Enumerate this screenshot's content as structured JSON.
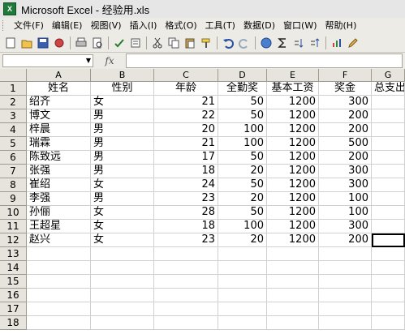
{
  "window": {
    "title": "Microsoft Excel - 经验用.xls",
    "app_icon_glyph": "X"
  },
  "menu": [
    "文件(F)",
    "编辑(E)",
    "视图(V)",
    "插入(I)",
    "格式(O)",
    "工具(T)",
    "数据(D)",
    "窗口(W)",
    "帮助(H)"
  ],
  "toolbar": {
    "icons": [
      "new-icon",
      "open-icon",
      "save-icon",
      "permission-icon",
      "print-icon",
      "print-preview-icon",
      "spelling-icon",
      "research-icon",
      "cut-icon",
      "copy-icon",
      "paste-icon",
      "format-painter-icon",
      "undo-icon",
      "redo-icon",
      "hyperlink-icon",
      "autosum-icon",
      "sort-ascending-icon",
      "sort-descending-icon",
      "chart-wizard-icon",
      "drawing-icon"
    ]
  },
  "formula_bar": {
    "name_box": "",
    "fx": "fx",
    "content": ""
  },
  "sheet": {
    "columns": [
      "A",
      "B",
      "C",
      "D",
      "E",
      "F",
      "G"
    ],
    "row_numbers": [
      "1",
      "2",
      "3",
      "4",
      "5",
      "6",
      "7",
      "8",
      "9",
      "10",
      "11",
      "12",
      "13",
      "14",
      "15",
      "16",
      "17",
      "18"
    ],
    "rows": [
      [
        "姓名",
        "性别",
        "年龄",
        "全勤奖",
        "基本工资",
        "奖金",
        "总支出"
      ],
      [
        "绍齐",
        "女",
        "21",
        "50",
        "1200",
        "300",
        ""
      ],
      [
        "博文",
        "男",
        "22",
        "50",
        "1200",
        "200",
        ""
      ],
      [
        "梓晨",
        "男",
        "20",
        "100",
        "1200",
        "200",
        ""
      ],
      [
        "瑞霖",
        "男",
        "21",
        "100",
        "1200",
        "500",
        ""
      ],
      [
        "陈致远",
        "男",
        "17",
        "50",
        "1200",
        "200",
        ""
      ],
      [
        "张强",
        "男",
        "18",
        "20",
        "1200",
        "300",
        ""
      ],
      [
        "崔绍",
        "女",
        "24",
        "50",
        "1200",
        "300",
        ""
      ],
      [
        "李强",
        "男",
        "23",
        "20",
        "1200",
        "100",
        ""
      ],
      [
        "孙俪",
        "女",
        "28",
        "50",
        "1200",
        "100",
        ""
      ],
      [
        "王超星",
        "女",
        "18",
        "100",
        "1200",
        "300",
        ""
      ],
      [
        "赵兴",
        "女",
        "23",
        "20",
        "1200",
        "200",
        ""
      ],
      [
        "",
        "",
        "",
        "",
        "",
        "",
        ""
      ],
      [
        "",
        "",
        "",
        "",
        "",
        "",
        ""
      ],
      [
        "",
        "",
        "",
        "",
        "",
        "",
        ""
      ],
      [
        "",
        "",
        "",
        "",
        "",
        "",
        ""
      ],
      [
        "",
        "",
        "",
        "",
        "",
        "",
        ""
      ],
      [
        "",
        "",
        "",
        "",
        "",
        "",
        ""
      ]
    ],
    "selected_cell": "G12"
  }
}
